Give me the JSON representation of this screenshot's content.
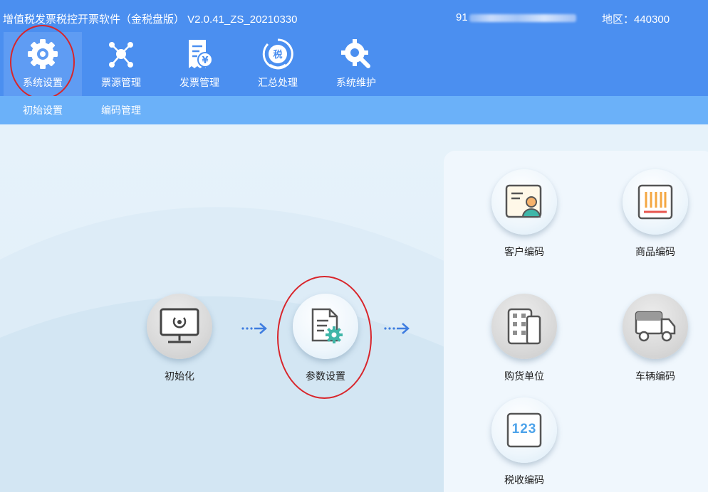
{
  "header": {
    "app_title": "增值税发票税控开票软件（金税盘版） V2.0.41_ZS_20210330",
    "tax_id_prefix": "91",
    "region": "地区：440300"
  },
  "nav": {
    "items": [
      {
        "label": "系统设置",
        "icon": "gear-icon"
      },
      {
        "label": "票源管理",
        "icon": "network-icon"
      },
      {
        "label": "发票管理",
        "icon": "invoice-icon"
      },
      {
        "label": "汇总处理",
        "icon": "tax-summary-icon"
      },
      {
        "label": "系统维护",
        "icon": "maintenance-icon"
      }
    ]
  },
  "subnav": {
    "items": [
      {
        "label": "初始设置"
      },
      {
        "label": "编码管理"
      }
    ]
  },
  "flow": {
    "nodes": [
      {
        "label": "初始化",
        "icon": "monitor-icon"
      },
      {
        "label": "参数设置",
        "icon": "document-settings-icon"
      }
    ]
  },
  "coding": {
    "items": [
      {
        "label": "客户编码",
        "icon": "customer-card-icon"
      },
      {
        "label": "商品编码",
        "icon": "barcode-icon"
      },
      {
        "label": "购货单位",
        "icon": "building-icon"
      },
      {
        "label": "车辆编码",
        "icon": "truck-icon"
      },
      {
        "label": "税收编码",
        "icon": "number-code-icon"
      },
      {
        "code_text": "123"
      }
    ]
  },
  "colors": {
    "header_bg": "#4b8ff0",
    "active_tab_bg": "#5f9cf3",
    "subnav_bg": "#6bb1f9",
    "annotation_red": "#d8252b"
  }
}
